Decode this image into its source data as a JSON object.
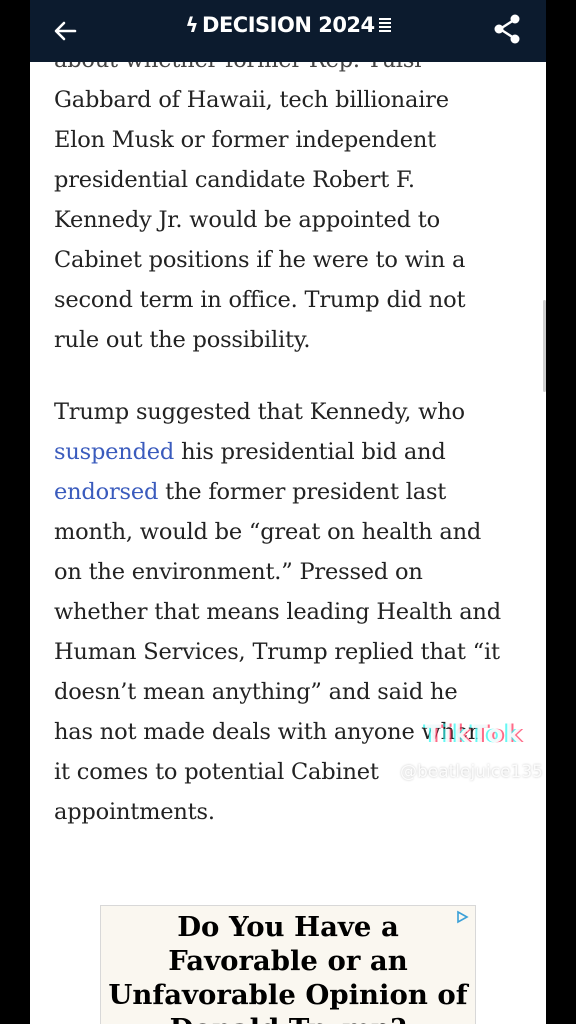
{
  "header": {
    "brand_title": "DECISION 2024",
    "back_icon": "arrow-left-icon",
    "share_icon": "share-icon"
  },
  "article": {
    "p1_lines": [
      "about whether former Rep. Tulsi",
      "Gabbard of Hawaii, tech billionaire",
      "Elon Musk or former independent",
      "presidential candidate Robert F.",
      "Kennedy Jr. would be appointed to",
      "Cabinet positions if he were to win a",
      "second term in office. Trump did not",
      "rule out the possibility."
    ],
    "p2": {
      "line1": "Trump suggested that Kennedy, who",
      "link1": "suspended",
      "line2_rest": " his presidential bid and",
      "link2": "endorsed",
      "line3_rest": " the former president last",
      "more_lines": [
        "month, would be “great on health and",
        "on the environment.” Pressed on",
        "whether that means leading Health and",
        "Human Services, Trump replied that “it",
        "doesn’t mean anything” and said he",
        "has not made deals with anyone when",
        "it comes to potential Cabinet",
        "appointments."
      ]
    }
  },
  "ad": {
    "lines": [
      "Do You Have a",
      "Favorable or an",
      "Unfavorable Opinion of",
      "Donald Trump?"
    ],
    "choice_icon": "ad-choices-icon"
  },
  "watermark": {
    "logo": "TikTok",
    "handle": "@beatlejuice135"
  },
  "colors": {
    "header_bg": "#0c1b2e",
    "link": "#3a5bbd",
    "body_text": "#222222"
  }
}
